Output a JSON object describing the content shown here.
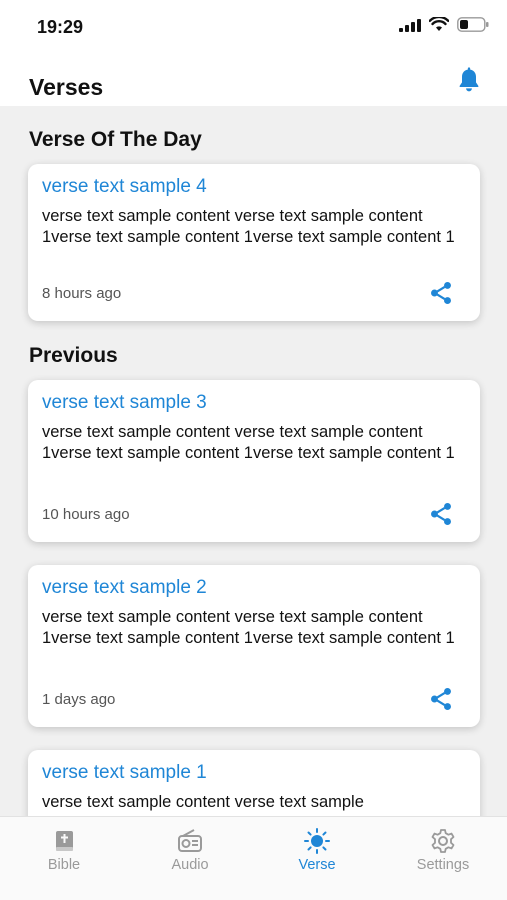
{
  "status_bar": {
    "time": "19:29"
  },
  "header": {
    "title": "Verses"
  },
  "sections": {
    "day_title": "Verse Of The Day",
    "previous_title": "Previous"
  },
  "cards": [
    {
      "title": "verse text sample 4",
      "body": "verse text sample content verse text sample content 1verse text sample content 1verse text sample content 1",
      "time": "8 hours ago"
    },
    {
      "title": "verse text sample 3",
      "body": "verse text sample content verse text sample content 1verse text sample content 1verse text sample content 1",
      "time": "10 hours ago"
    },
    {
      "title": "verse text sample 2",
      "body": "verse text sample content verse text sample content 1verse text sample content 1verse text sample content 1",
      "time": "1 days ago"
    },
    {
      "title": "verse text sample 1",
      "body": "verse text sample content verse text sample"
    }
  ],
  "tabbar": {
    "tabs": [
      {
        "label": "Bible",
        "icon": "book-icon"
      },
      {
        "label": "Audio",
        "icon": "radio-icon"
      },
      {
        "label": "Verse",
        "icon": "sun-icon",
        "active": true
      },
      {
        "label": "Settings",
        "icon": "gear-icon"
      }
    ]
  },
  "colors": {
    "accent": "#1f86d6",
    "background": "#f0f0f0"
  }
}
